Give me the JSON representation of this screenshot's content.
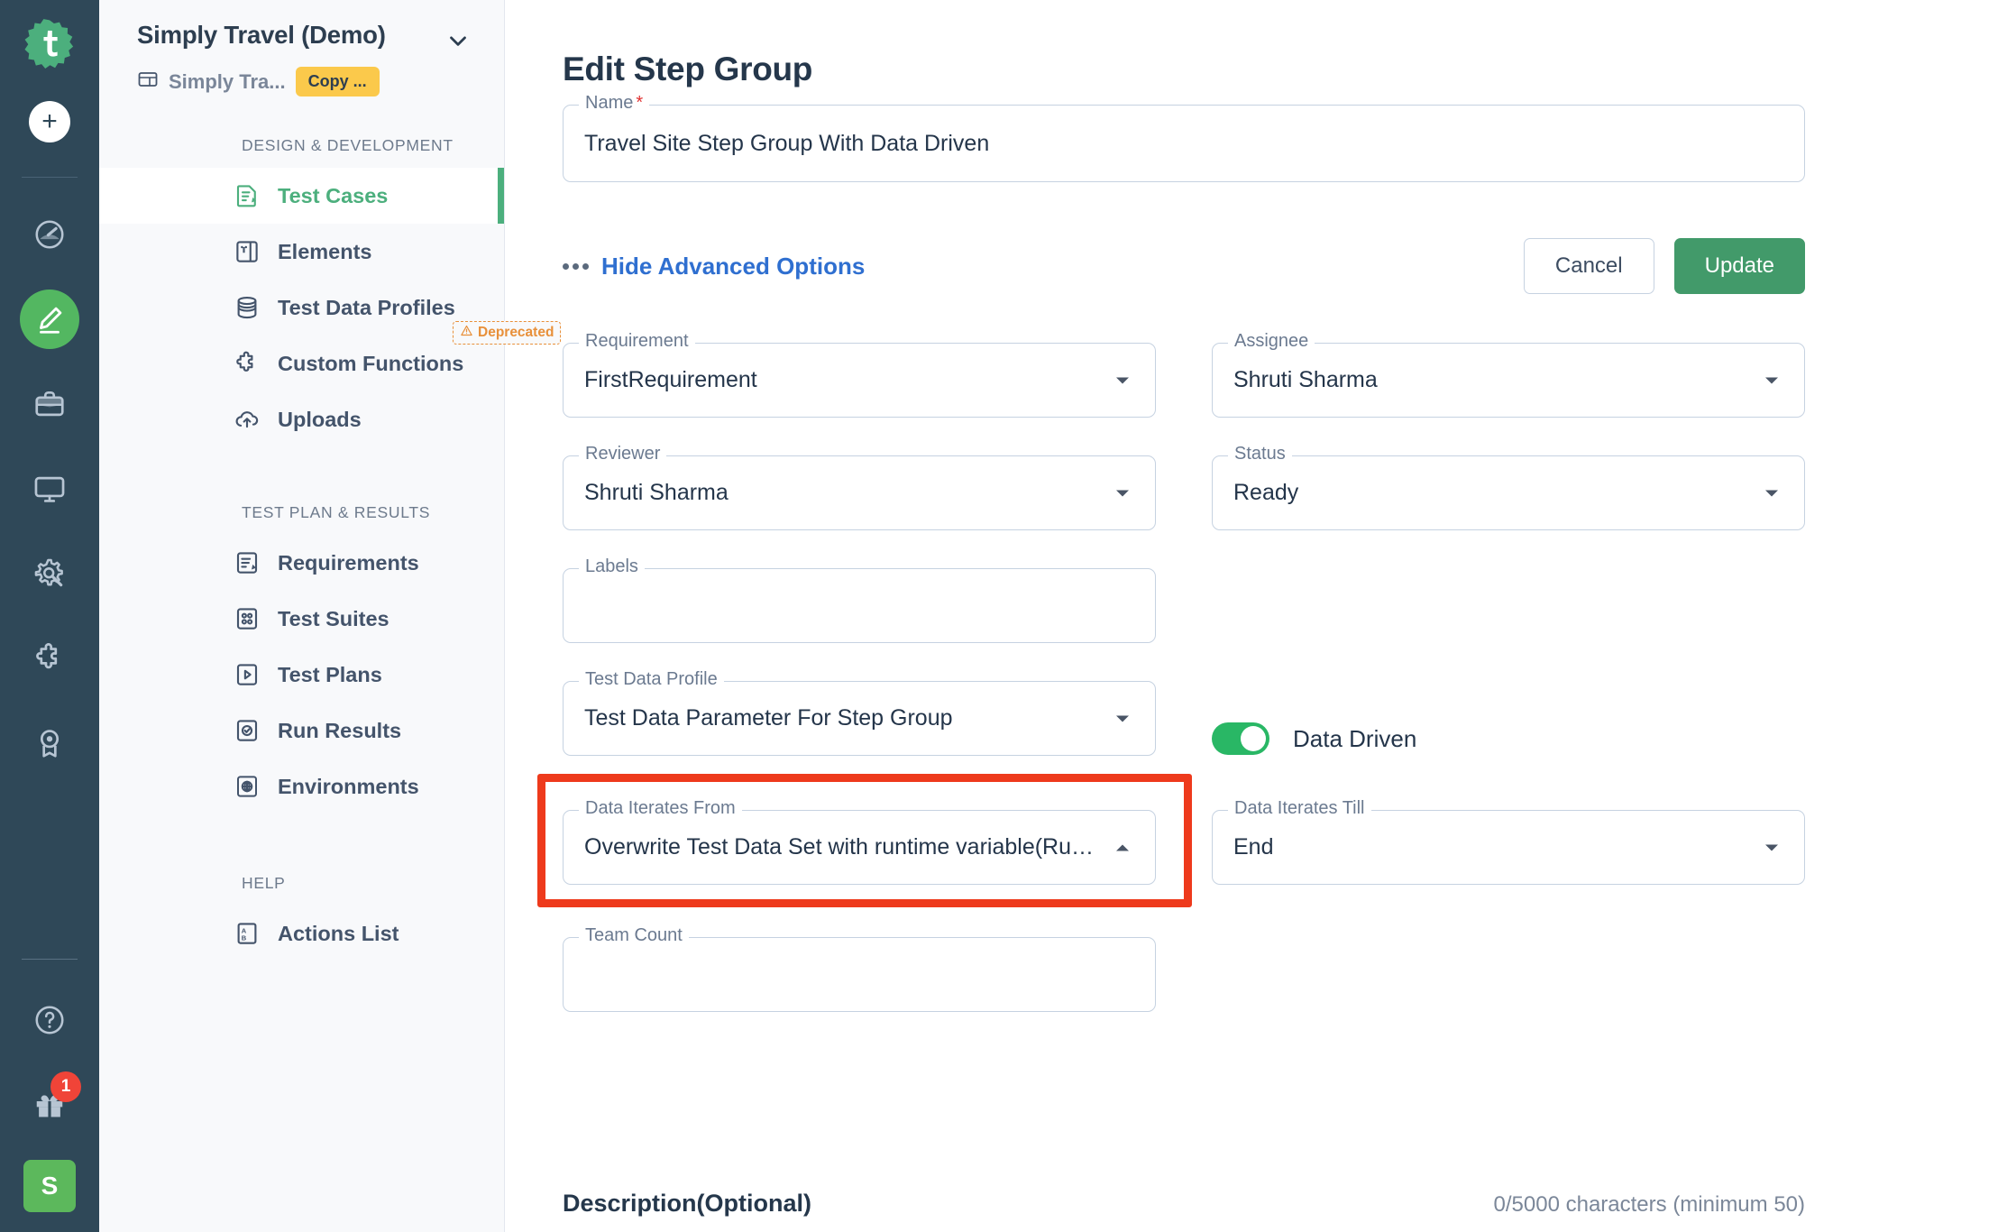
{
  "rail": {
    "logo_icon": "testsigma-logo-icon",
    "add_label": "+",
    "items": [
      {
        "icon": "speedometer-icon",
        "name": "dashboard"
      },
      {
        "icon": "pencil-icon",
        "name": "create",
        "active": true
      },
      {
        "icon": "briefcase-icon",
        "name": "projects"
      },
      {
        "icon": "monitor-icon",
        "name": "devices"
      },
      {
        "icon": "gear-wrench-icon",
        "name": "settings"
      },
      {
        "icon": "puzzle-icon",
        "name": "addons"
      },
      {
        "icon": "award-badge-icon",
        "name": "achievements"
      }
    ],
    "help_icon": "question-circle-icon",
    "gift_icon": "gift-icon",
    "gift_badge": "1",
    "avatar_initial": "S"
  },
  "sidebar": {
    "project_title": "Simply Travel (Demo)",
    "project_sub": "Simply Tra...",
    "project_sub_icon": "application-icon",
    "copy_pill": "Copy ...",
    "caret_icon": "chevron-down-icon",
    "sections": [
      {
        "title": "DESIGN & DEVELOPMENT",
        "items": [
          {
            "label": "Test Cases",
            "icon": "test-case-icon",
            "active": true
          },
          {
            "label": "Elements",
            "icon": "elements-icon",
            "active": false
          },
          {
            "label": "Test Data Profiles",
            "icon": "database-icon",
            "active": false
          },
          {
            "label": "Custom Functions",
            "icon": "puzzle-icon",
            "active": false,
            "badge": "Deprecated",
            "badge_icon": "warning-triangle-icon"
          },
          {
            "label": "Uploads",
            "icon": "upload-cloud-icon",
            "active": false
          }
        ]
      },
      {
        "title": "TEST PLAN & RESULTS",
        "items": [
          {
            "label": "Requirements",
            "icon": "requirements-icon",
            "active": false
          },
          {
            "label": "Test Suites",
            "icon": "test-suite-icon",
            "active": false
          },
          {
            "label": "Test Plans",
            "icon": "play-square-icon",
            "active": false
          },
          {
            "label": "Run Results",
            "icon": "run-results-icon",
            "active": false
          },
          {
            "label": "Environments",
            "icon": "globe-square-icon",
            "active": false
          }
        ]
      },
      {
        "title": "HELP",
        "items": [
          {
            "label": "Actions List",
            "icon": "actions-list-icon",
            "active": false
          }
        ]
      }
    ]
  },
  "main": {
    "page_title": "Edit Step Group",
    "name_field": {
      "label": "Name",
      "required_marker": "*",
      "value": "Travel Site Step Group With Data Driven"
    },
    "advanced_link": "Hide Advanced Options",
    "advanced_icon": "three-dots-icon",
    "cancel_label": "Cancel",
    "update_label": "Update",
    "fields": {
      "requirement": {
        "label": "Requirement",
        "value": "FirstRequirement",
        "caret": "chevron-down-icon"
      },
      "assignee": {
        "label": "Assignee",
        "value": "Shruti Sharma",
        "caret": "chevron-down-icon"
      },
      "reviewer": {
        "label": "Reviewer",
        "value": "Shruti Sharma",
        "caret": "chevron-down-icon"
      },
      "status": {
        "label": "Status",
        "value": "Ready",
        "caret": "chevron-down-icon"
      },
      "labels": {
        "label": "Labels",
        "value": ""
      },
      "test_data_profile": {
        "label": "Test Data Profile",
        "value": "Test Data Parameter For Step Group",
        "caret": "chevron-down-icon"
      },
      "data_iterates_from": {
        "label": "Data Iterates From",
        "value": "Overwrite Test Data Set with runtime variable(Run…",
        "caret": "chevron-up-icon",
        "highlighted": true
      },
      "data_iterates_till": {
        "label": "Data Iterates Till",
        "value": "End",
        "caret": "chevron-down-icon"
      },
      "team_count": {
        "label": "Team Count",
        "value": ""
      }
    },
    "data_driven": {
      "label": "Data Driven",
      "enabled": true
    },
    "description": {
      "title": "Description(Optional)",
      "counter": "0/5000 characters (minimum 50)"
    }
  },
  "colors": {
    "rail_bg": "#2f4858",
    "accent_green": "#4caf7d",
    "update_green": "#429a6a",
    "highlight_red": "#ee3a1c",
    "link_blue": "#2f6fd0",
    "pill_yellow": "#fbc94b",
    "deprecated_orange": "#e8903a",
    "toggle_green": "#29b765",
    "badge_red": "#f04438"
  }
}
